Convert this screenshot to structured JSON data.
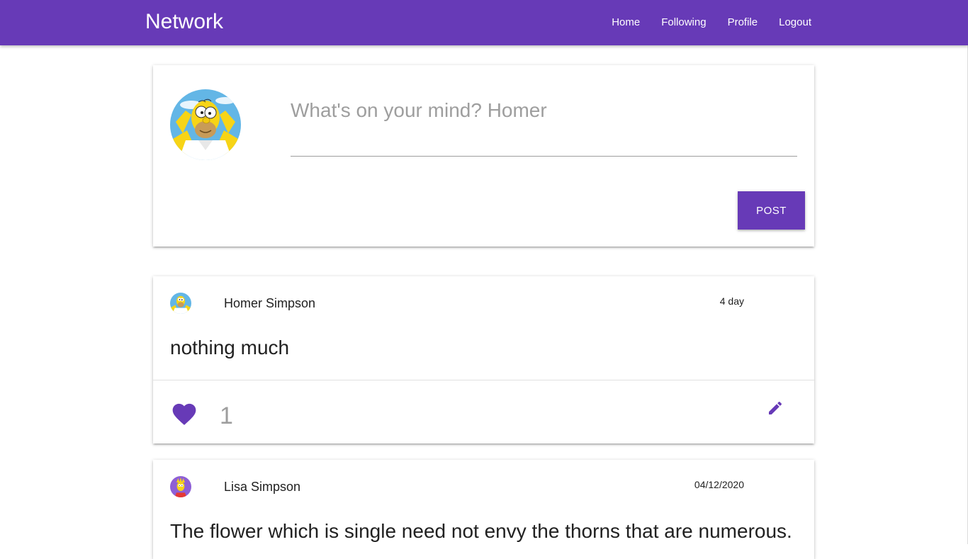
{
  "navbar": {
    "brand": "Network",
    "links": [
      "Home",
      "Following",
      "Profile",
      "Logout"
    ],
    "color": "#673ab7"
  },
  "compose": {
    "placeholder": "What's on your mind? Homer",
    "post_button": "POST",
    "avatar": "homer-avatar"
  },
  "posts": [
    {
      "author": "Homer Simpson",
      "date": "4 day",
      "content": "nothing much",
      "likes": "1",
      "liked": true,
      "editable": true,
      "avatar": "homer-avatar"
    },
    {
      "author": "Lisa Simpson",
      "date": "04/12/2020",
      "content": "The flower which is single need not envy the thorns that are numerous.",
      "avatar": "lisa-avatar"
    }
  ],
  "icons": {
    "like": "heart-icon",
    "edit": "pencil-icon"
  },
  "colors": {
    "accent": "#673ab7",
    "muted": "#9e9e9e"
  }
}
